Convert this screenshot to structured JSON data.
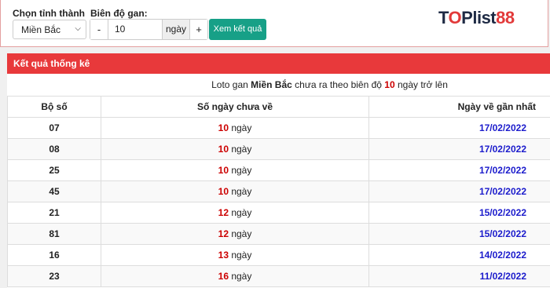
{
  "filters": {
    "province_label": "Chọn tỉnh thành",
    "province_value": "Miền Bắc",
    "range_label": "Biên độ gan:",
    "minus": "-",
    "range_value": "10",
    "unit": "ngày",
    "plus": "+",
    "submit_label": "Xem kết quả"
  },
  "logo": {
    "part1": "T",
    "part2": "O",
    "part3": "Plist",
    "part4": "88"
  },
  "panel": {
    "title": "Kết quả thống kê",
    "summary_pre": "Loto gan ",
    "summary_region": "Miền Bắc",
    "summary_mid": " chưa ra theo biên độ ",
    "summary_days": "10",
    "summary_post": " ngày trở lên"
  },
  "table": {
    "headers": [
      "Bộ số",
      "Số ngày chưa về",
      "Ngày về gần nhất"
    ],
    "unit": " ngày",
    "rows": [
      {
        "num": "07",
        "days": "10",
        "date": "17/02/2022"
      },
      {
        "num": "08",
        "days": "10",
        "date": "17/02/2022"
      },
      {
        "num": "25",
        "days": "10",
        "date": "17/02/2022"
      },
      {
        "num": "45",
        "days": "10",
        "date": "17/02/2022"
      },
      {
        "num": "21",
        "days": "12",
        "date": "15/02/2022"
      },
      {
        "num": "81",
        "days": "12",
        "date": "15/02/2022"
      },
      {
        "num": "16",
        "days": "13",
        "date": "14/02/2022"
      },
      {
        "num": "23",
        "days": "16",
        "date": "11/02/2022"
      }
    ]
  }
}
